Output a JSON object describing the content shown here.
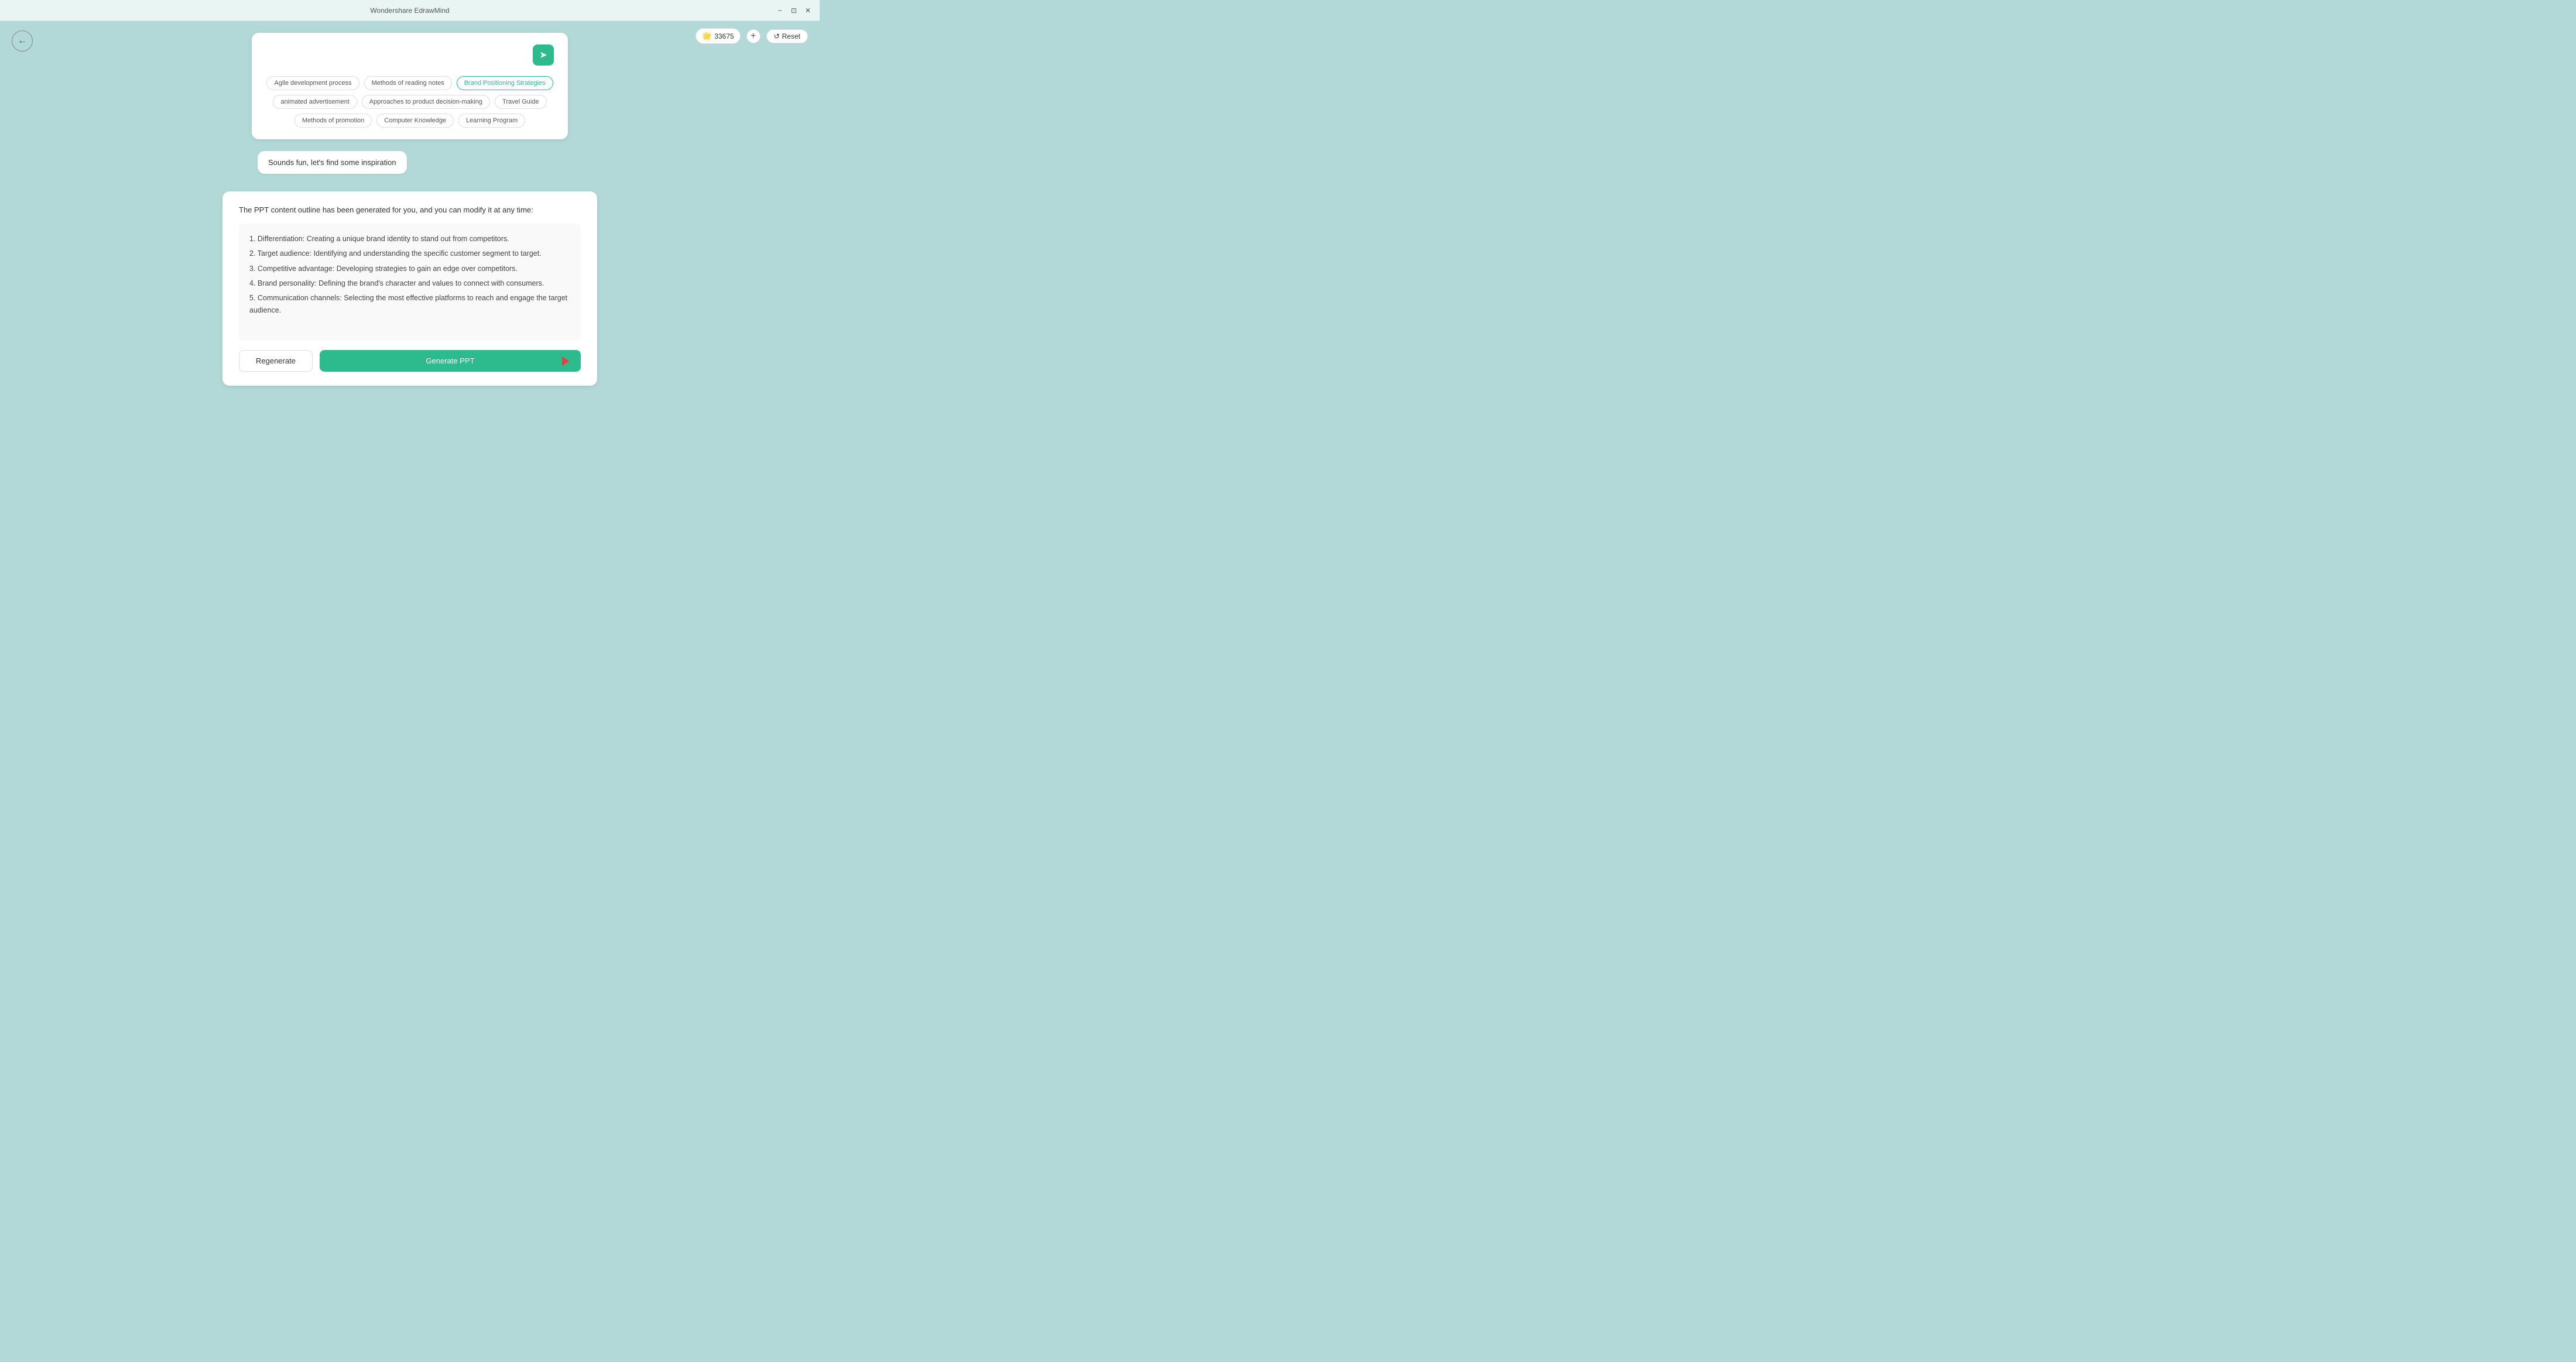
{
  "titleBar": {
    "title": "Wondershare EdrawMind",
    "controls": {
      "minimize": "−",
      "maximize": "⊡",
      "close": "✕"
    }
  },
  "backButton": {
    "icon": "←"
  },
  "topRight": {
    "pointsIcon": "🌟",
    "points": "33675",
    "addLabel": "+",
    "resetIcon": "↺",
    "resetLabel": "Reset"
  },
  "topicCard": {
    "inputPlaceholder": "",
    "sendIcon": "➤",
    "tags": [
      {
        "label": "Agile development process",
        "active": false
      },
      {
        "label": "Methods of reading notes",
        "active": false
      },
      {
        "label": "Brand Positioning Strategies",
        "active": true
      },
      {
        "label": "animated advertisement",
        "active": false
      },
      {
        "label": "Approaches to product decision-making",
        "active": false
      },
      {
        "label": "Travel Guide",
        "active": false
      },
      {
        "label": "Methods of promotion",
        "active": false
      },
      {
        "label": "Computer Knowledge",
        "active": false
      },
      {
        "label": "Learning Program",
        "active": false
      }
    ]
  },
  "userMessage": {
    "text": "Sounds fun, let's find some inspiration"
  },
  "aiResponse": {
    "header": "The PPT content outline has been generated for you, and you can modify it at any time:",
    "points": [
      "1. Differentiation: Creating a unique brand identity to stand out from competitors.",
      "2. Target audience: Identifying and understanding the specific customer segment to target.",
      "3. Competitive advantage: Developing strategies to gain an edge over competitors.",
      "4. Brand personality: Defining the brand's character and values to connect with consumers.",
      "5. Communication channels: Selecting the most effective platforms to reach and engage the target audience."
    ],
    "regenerateLabel": "Regenerate",
    "generatePPTLabel": "Generate PPT"
  }
}
